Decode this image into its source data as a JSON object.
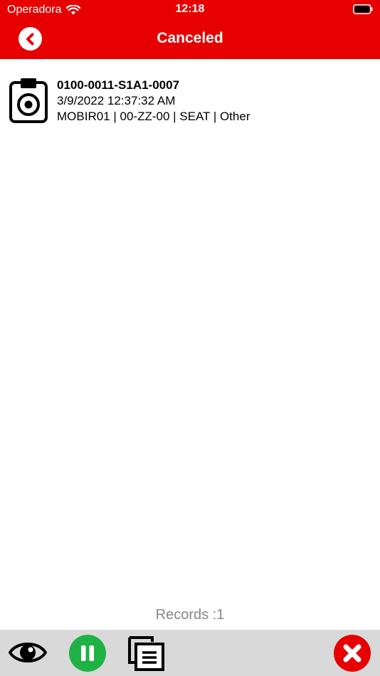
{
  "status_bar": {
    "carrier": "Operadora",
    "time": "12:18"
  },
  "header": {
    "title": "Canceled"
  },
  "list": {
    "items": [
      {
        "code": "0100-0011-S1A1-0007",
        "datetime": "3/9/2022 12:37:32 AM",
        "details": "MOBIR01 | 00-ZZ-00 | SEAT | Other",
        "icon": "clipboard-target-icon"
      }
    ]
  },
  "footer": {
    "records_label": "Records :1"
  },
  "toolbar": {
    "buttons": [
      {
        "icon": "eye-icon"
      },
      {
        "icon": "pause-icon",
        "color": "#1fb244"
      },
      {
        "icon": "documents-icon"
      },
      {
        "icon": "close-icon",
        "color": "#e60000"
      }
    ]
  },
  "colors": {
    "brand": "#e60000",
    "toolbar_bg": "#d9d9d9",
    "records_text": "#888888"
  }
}
